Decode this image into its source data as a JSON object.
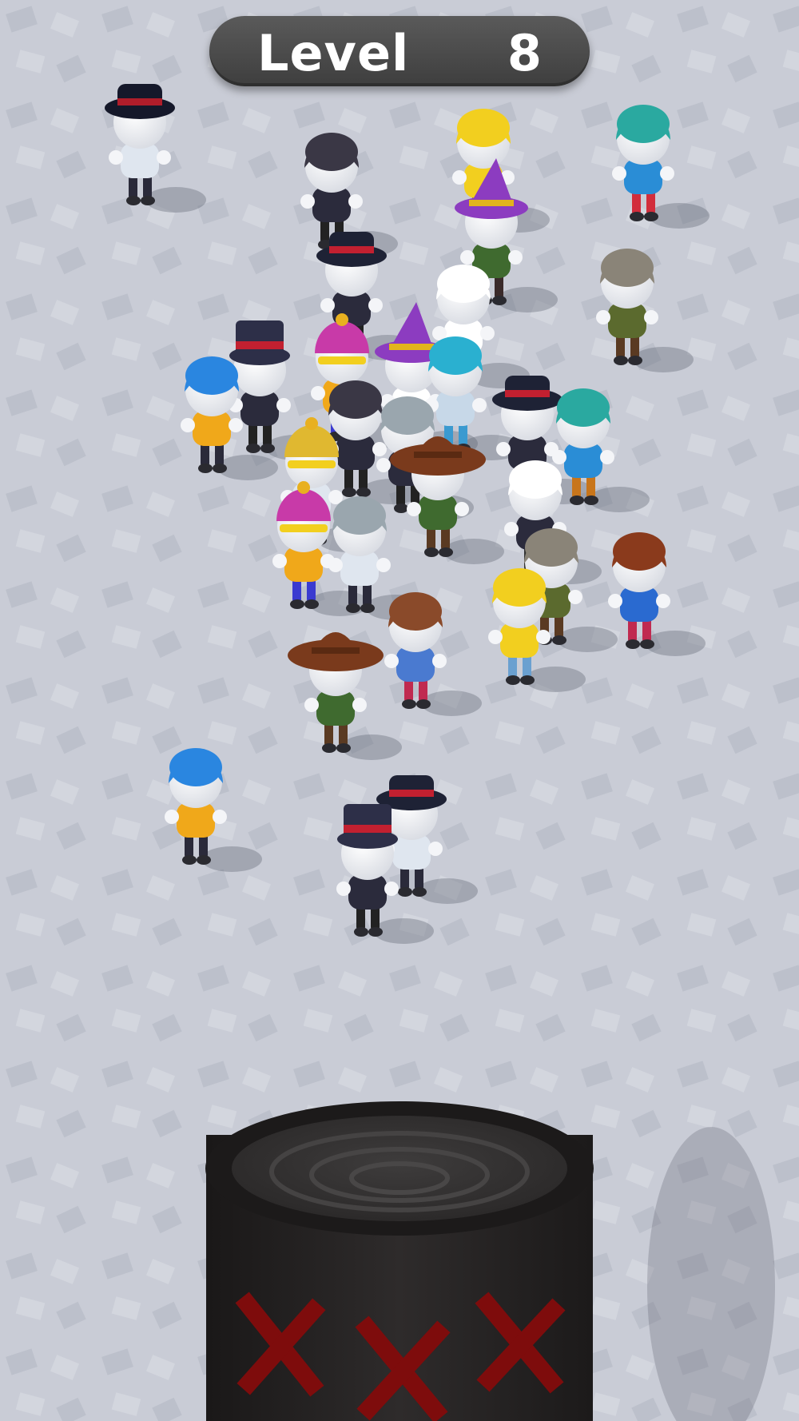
{
  "hud": {
    "level_label": "Level",
    "level_number": "8"
  },
  "colors": {
    "floor": "#c9ccd6",
    "floor_tile": "#b8bcc8",
    "hud_pill": "#4b4b4b",
    "hud_text": "#ffffff",
    "bin_body": "#2b2828",
    "bin_top": "#3a3838",
    "bin_marks": "#8a0f0f"
  },
  "characters": [
    {
      "hair": "#1b1b2a",
      "hat": "fedora",
      "hat_color": "#15182a",
      "band": "#b01d2a",
      "body": "#dfe6ef",
      "legs": "#2a2a3a"
    },
    {
      "hair": "#3a3745",
      "hat": "none",
      "hat_color": "#3a3745",
      "band": "#000000",
      "body": "#2b2b3c",
      "legs": "#222"
    },
    {
      "hair": "#f2cf1f",
      "hat": "none",
      "hat_color": "#f2cf1f",
      "band": "#000000",
      "body": "#f2cf1f",
      "legs": "#555"
    },
    {
      "hair": "#2aa9a0",
      "hat": "none",
      "hat_color": "#2aa9a0",
      "band": "#000000",
      "body": "#2a8dd6",
      "legs": "#d22d3c"
    },
    {
      "hair": "#8c3cc0",
      "hat": "wizard",
      "hat_color": "#8c3cc0",
      "band": "#e2b41c",
      "body": "#3f6a2f",
      "legs": "#3a2a2a"
    },
    {
      "hair": "#1e2235",
      "hat": "fedora",
      "hat_color": "#1e2235",
      "band": "#c22030",
      "body": "#2b2b3c",
      "legs": "#222"
    },
    {
      "hair": "#ffffff",
      "hat": "none",
      "hat_color": "#ffffff",
      "band": "#000000",
      "body": "#ffffff",
      "legs": "#555"
    },
    {
      "hair": "#8a8478",
      "hat": "none",
      "hat_color": "#8a8478",
      "band": "#000000",
      "body": "#5b6a2e",
      "legs": "#5a3a22"
    },
    {
      "hair": "#2d2f48",
      "hat": "tophat",
      "hat_color": "#2d2f48",
      "band": "#c22030",
      "body": "#2b2b3c",
      "legs": "#222"
    },
    {
      "hair": "#2a86e0",
      "hat": "none",
      "hat_color": "#2a86e0",
      "band": "#000000",
      "body": "#f0a81a",
      "legs": "#2a2a3a"
    },
    {
      "hair": "#c83aa8",
      "hat": "beanie",
      "hat_color": "#c83aa8",
      "band": "#000000",
      "body": "#f0a81a",
      "legs": "#3a3ad0"
    },
    {
      "hair": "#8c3cc0",
      "hat": "wizard",
      "hat_color": "#8c3cc0",
      "band": "#e2b41c",
      "body": "#ffffff",
      "legs": "#3a3a4a"
    },
    {
      "hair": "#2ab0d0",
      "hat": "none",
      "hat_color": "#f2d21f",
      "band": "#000000",
      "body": "#c7d8e8",
      "legs": "#3a9ad0"
    },
    {
      "hair": "#1e2235",
      "hat": "fedora",
      "hat_color": "#1e2235",
      "band": "#c22030",
      "body": "#2b2b3c",
      "legs": "#d02060"
    },
    {
      "hair": "#2aa9a0",
      "hat": "none",
      "hat_color": "#2aa9a0",
      "band": "#000000",
      "body": "#2a8dd6",
      "legs": "#c8751a"
    },
    {
      "hair": "#3a3745",
      "hat": "none",
      "hat_color": "#3a3745",
      "band": "#000000",
      "body": "#2b2b3c",
      "legs": "#222"
    },
    {
      "hair": "#9aa6ae",
      "hat": "none",
      "hat_color": "#9aa6ae",
      "band": "#000000",
      "body": "#2b2b3c",
      "legs": "#222"
    },
    {
      "hair": "#2a5ab0",
      "hat": "beanie",
      "hat_color": "#e0b830",
      "band": "#000000",
      "body": "#dfe6ef",
      "legs": "#2a2a3a"
    },
    {
      "hair": "#7a3a1c",
      "hat": "cowboy",
      "hat_color": "#7a3a1c",
      "band": "#5a2a12",
      "body": "#3f6a2f",
      "legs": "#5a3a22"
    },
    {
      "hair": "#ffffff",
      "hat": "none",
      "hat_color": "#ffffff",
      "band": "#000000",
      "body": "#2b2b3c",
      "legs": "#333"
    },
    {
      "hair": "#c83aa8",
      "hat": "beanie",
      "hat_color": "#c83aa8",
      "band": "#000000",
      "body": "#f0a81a",
      "legs": "#3a3ad0"
    },
    {
      "hair": "#9aa6ae",
      "hat": "none",
      "hat_color": "#9aa6ae",
      "band": "#000000",
      "body": "#dfe6ef",
      "legs": "#2a2a3a"
    },
    {
      "hair": "#8a8478",
      "hat": "none",
      "hat_color": "#8a8478",
      "band": "#000000",
      "body": "#5b6a2e",
      "legs": "#5a3a22"
    },
    {
      "hair": "#8a3a1c",
      "hat": "none",
      "hat_color": "#8a3a1c",
      "band": "#000000",
      "body": "#2a6ad0",
      "legs": "#c02a50"
    },
    {
      "hair": "#f2cf1f",
      "hat": "none",
      "hat_color": "#f2cf1f",
      "band": "#000000",
      "body": "#f2cf1f",
      "legs": "#6aa0d0"
    },
    {
      "hair": "#8a4a2a",
      "hat": "none",
      "hat_color": "#8a4a2a",
      "band": "#000000",
      "body": "#4a7ad0",
      "legs": "#c02a50"
    },
    {
      "hair": "#7a3a1c",
      "hat": "cowboy",
      "hat_color": "#7a3a1c",
      "band": "#5a2a12",
      "body": "#3f6a2f",
      "legs": "#5a3a22"
    },
    {
      "hair": "#2a86e0",
      "hat": "none",
      "hat_color": "#2a86e0",
      "band": "#000000",
      "body": "#f0a81a",
      "legs": "#2a2a3a"
    },
    {
      "hair": "#1e2235",
      "hat": "fedora",
      "hat_color": "#1e2235",
      "band": "#c22030",
      "body": "#dfe6ef",
      "legs": "#2a2a3a"
    },
    {
      "hair": "#2d2f48",
      "hat": "tophat",
      "hat_color": "#2d2f48",
      "band": "#c22030",
      "body": "#2b2b3c",
      "legs": "#222"
    }
  ]
}
